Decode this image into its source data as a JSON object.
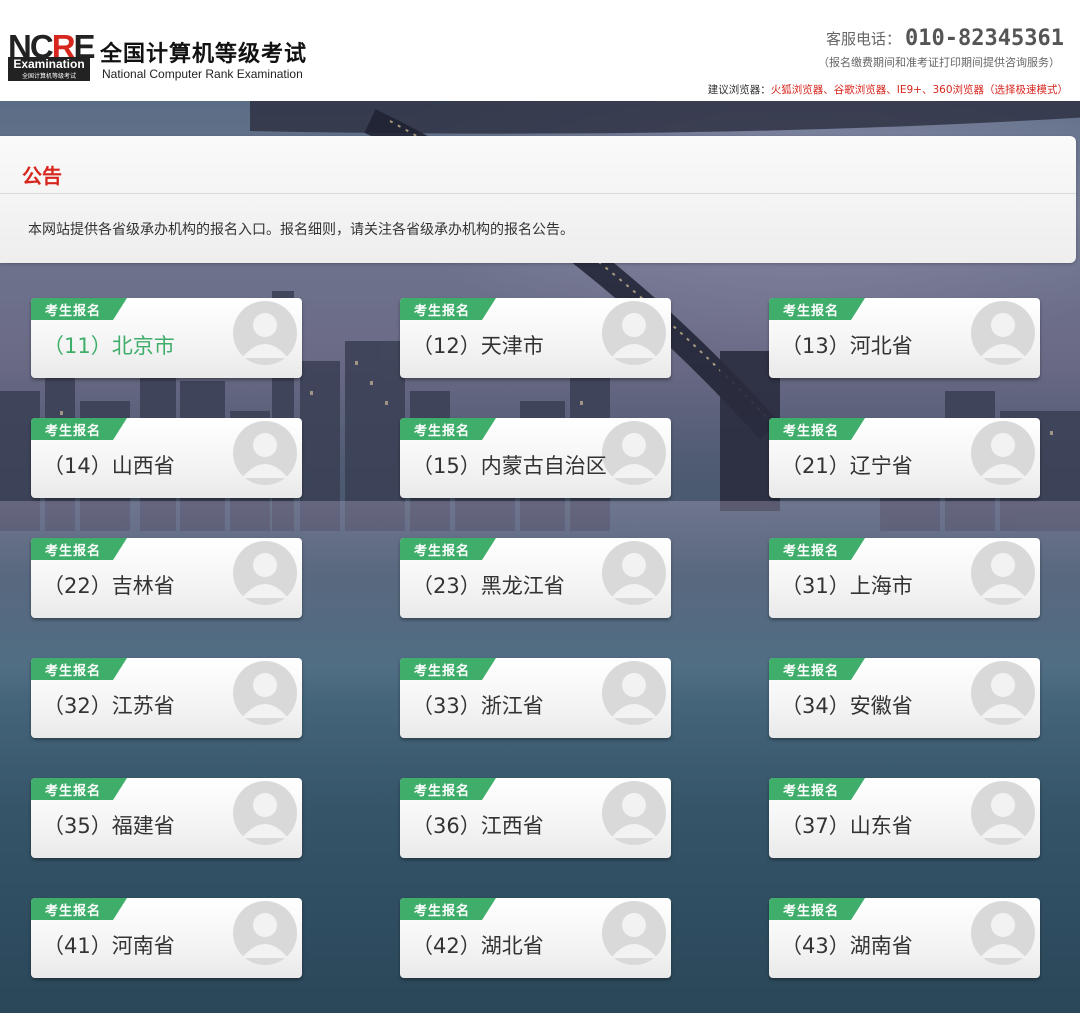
{
  "header": {
    "logo_text": "NCRE",
    "logo_exam": "Examination",
    "logo_sub": "全国计算机等级考试",
    "title_cn": "全国计算机等级考试",
    "title_en": "National Computer Rank Examination",
    "hotline_label": "客服电话：",
    "hotline_number": "010-82345361",
    "hotline_note": "（报名缴费期间和准考证打印期间提供咨询服务）",
    "browser_label": "建议浏览器：",
    "browser_list": "火狐浏览器、谷歌浏览器、IE9+、360浏览器（选择极速模式）"
  },
  "notice": {
    "title": "公告",
    "text": "本网站提供各省级承办机构的报名入口。报名细则，请关注各省级承办机构的报名公告。"
  },
  "cards": {
    "tag_label": "考生报名",
    "items": [
      {
        "label": "（11）北京市",
        "active": true
      },
      {
        "label": "（12）天津市"
      },
      {
        "label": "（13）河北省"
      },
      {
        "label": "（14）山西省"
      },
      {
        "label": "（15）内蒙古自治区"
      },
      {
        "label": "（21）辽宁省"
      },
      {
        "label": "（22）吉林省"
      },
      {
        "label": "（23）黑龙江省"
      },
      {
        "label": "（31）上海市"
      },
      {
        "label": "（32）江苏省"
      },
      {
        "label": "（33）浙江省"
      },
      {
        "label": "（34）安徽省"
      },
      {
        "label": "（35）福建省"
      },
      {
        "label": "（36）江西省"
      },
      {
        "label": "（37）山东省"
      },
      {
        "label": "（41）河南省"
      },
      {
        "label": "（42）湖北省"
      },
      {
        "label": "（43）湖南省"
      }
    ]
  },
  "colors": {
    "accent_red": "#d7261e",
    "tag_green": "#3fae6a",
    "active_text": "#3fae6a"
  },
  "icons": {
    "card_avatar": "user-silhouette-icon"
  }
}
